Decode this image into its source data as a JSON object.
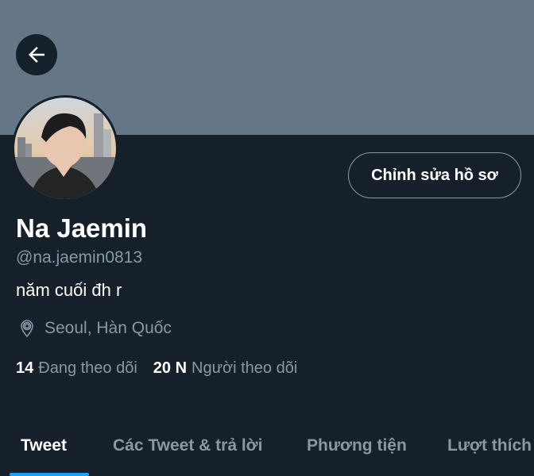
{
  "colors": {
    "background": "#15202b",
    "banner": "#657786",
    "text_primary": "#ffffff",
    "text_secondary": "#8899a6",
    "accent": "#1da1f2"
  },
  "header": {
    "back_icon": "arrow-left-icon"
  },
  "profile": {
    "avatar_icon": "profile-photo",
    "edit_button_label": "Chỉnh sửa hồ sơ",
    "display_name": "Na Jaemin",
    "handle": "@na.jaemin0813",
    "bio": "năm cuối đh r",
    "location_icon": "location-pin-icon",
    "location": "Seoul, Hàn Quốc",
    "following_count": "14",
    "following_label": "Đang theo dõi",
    "followers_count": "20 N",
    "followers_label": "Người theo dõi"
  },
  "tabs": [
    {
      "label": "Tweet",
      "active": true
    },
    {
      "label": "Các Tweet & trả lời",
      "active": false
    },
    {
      "label": "Phương tiện",
      "active": false
    },
    {
      "label": "Lượt thích",
      "active": false
    }
  ]
}
